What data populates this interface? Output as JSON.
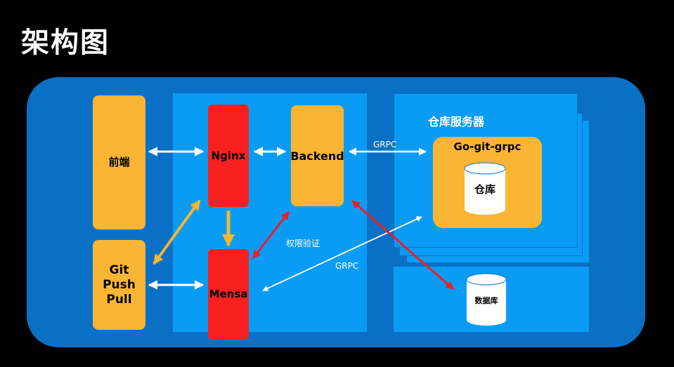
{
  "title": "架构图",
  "nodes": {
    "frontend": "前端",
    "git_push_pull": [
      "Git",
      "Push",
      "Pull"
    ],
    "nginx": "Nginx",
    "backend": "Backend",
    "mensa": "Mensa",
    "repo_server_title": "仓库服务器",
    "go_git_grpc": "Go-git-grpc",
    "repo_db": "仓库",
    "database": "数据库"
  },
  "edge_labels": {
    "grpc_top": "GRPC",
    "auth": "权限验证",
    "grpc_mid": "GRPC"
  },
  "colors": {
    "white_arrow": "#ffffff",
    "red_arrow": "#e8202a",
    "yellow_arrow": "#f7b531"
  }
}
